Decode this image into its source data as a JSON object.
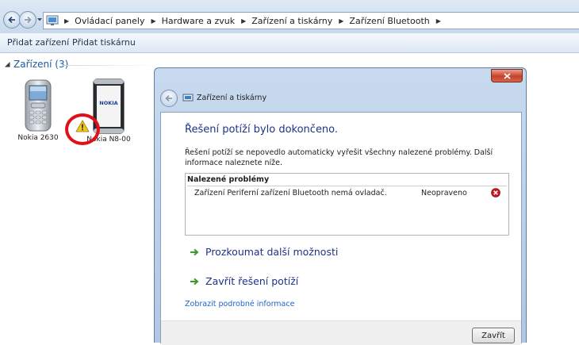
{
  "address_bar": {
    "breadcrumbs": [
      "Ovládací panely",
      "Hardware a zvuk",
      "Zařízení a tiskárny",
      "Zařízení Bluetooth"
    ]
  },
  "command_bar": {
    "add_device": "Přidat zařízení",
    "add_printer": "Přidat tiskárnu"
  },
  "devices_group": {
    "header": "Zařízení (3)",
    "items": [
      {
        "name": "Nokia 2630",
        "icon": "phone-icon"
      },
      {
        "name": "Nokia N8-00",
        "icon": "smartphone-icon",
        "warning": true
      }
    ],
    "phone_screen_brand": "NOKIA"
  },
  "dialog": {
    "title": "Zařízení a tiskárny",
    "heading": "Řešení potíží bylo dokončeno.",
    "description": "Řešení potíží se nepovedlo automaticky vyřešit všechny nalezené problémy. Další informace naleznete níže.",
    "problems": {
      "header": "Nalezené problémy",
      "items": [
        {
          "text": "Zařízení Periferní zařízení Bluetooth nemá ovladač.",
          "status": "Neopraveno",
          "status_icon": "error-icon"
        }
      ]
    },
    "tasks": [
      {
        "label": "Prozkoumat další možnosti"
      },
      {
        "label": "Zavřít řešení potíží"
      }
    ],
    "detail_link": "Zobrazit podrobné informace",
    "close_button": "Zavřít"
  },
  "colors": {
    "heading_blue": "#1e3287",
    "link_blue": "#1e64c8",
    "error_red": "#c8141e",
    "green_arrow": "#3c9b28",
    "annotation_red": "#e0101a"
  }
}
